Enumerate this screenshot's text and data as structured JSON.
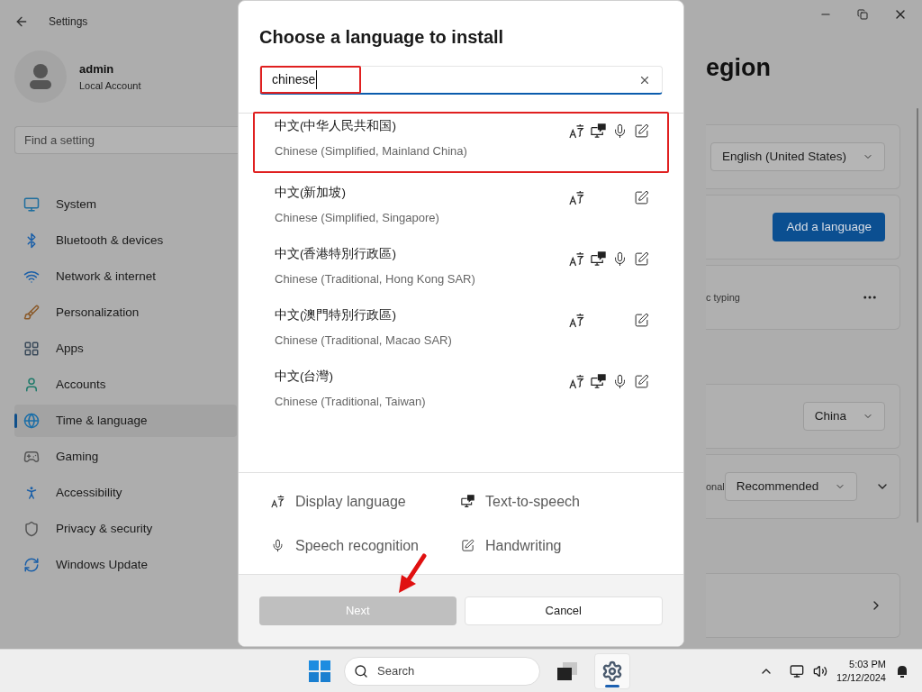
{
  "settings_window": {
    "title": "Settings",
    "user": {
      "name": "admin",
      "account": "Local Account"
    },
    "search": {
      "placeholder": "Find a setting"
    },
    "nav": [
      {
        "label": "System",
        "selected": false
      },
      {
        "label": "Bluetooth & devices",
        "selected": false
      },
      {
        "label": "Network & internet",
        "selected": false
      },
      {
        "label": "Personalization",
        "selected": false
      },
      {
        "label": "Apps",
        "selected": false
      },
      {
        "label": "Accounts",
        "selected": false
      },
      {
        "label": "Time & language",
        "selected": true
      },
      {
        "label": "Gaming",
        "selected": false
      },
      {
        "label": "Accessibility",
        "selected": false
      },
      {
        "label": "Privacy & security",
        "selected": false
      },
      {
        "label": "Windows Update",
        "selected": false
      }
    ],
    "page_heading": "egion",
    "sections": [
      {
        "cards": [
          {
            "kind": "dropdown",
            "value": "English (United States)",
            "expander": false
          },
          {
            "kind": "button",
            "label": "Add a language"
          },
          {
            "kind": "more",
            "text": "c typing"
          }
        ]
      },
      {
        "cards": [
          {
            "kind": "dropdown",
            "value": "China",
            "expander": false
          },
          {
            "kind": "dropdown",
            "text": "onal",
            "value": "Recommended",
            "expander": true
          }
        ]
      },
      {
        "cards": [
          {
            "kind": "link"
          }
        ]
      }
    ]
  },
  "dialog": {
    "title": "Choose a language to install",
    "search": {
      "value": "chinese",
      "marked": true
    },
    "languages": [
      {
        "native": "中文(中华人民共和国)",
        "english": "Chinese (Simplified, Mainland China)",
        "marked": true,
        "features": {
          "display_language": true,
          "text_to_speech": true,
          "speech_recognition": true,
          "handwriting": true
        }
      },
      {
        "native": "中文(新加坡)",
        "english": "Chinese (Simplified, Singapore)",
        "marked": false,
        "features": {
          "display_language": true,
          "text_to_speech": false,
          "speech_recognition": false,
          "handwriting": true
        }
      },
      {
        "native": "中文(香港特別行政區)",
        "english": "Chinese (Traditional, Hong Kong SAR)",
        "marked": false,
        "features": {
          "display_language": true,
          "text_to_speech": true,
          "speech_recognition": true,
          "handwriting": true
        }
      },
      {
        "native": "中文(澳門特別行政區)",
        "english": "Chinese (Traditional, Macao SAR)",
        "marked": false,
        "features": {
          "display_language": true,
          "text_to_speech": false,
          "speech_recognition": false,
          "handwriting": true
        }
      },
      {
        "native": "中文(台灣)",
        "english": "Chinese (Traditional, Taiwan)",
        "marked": false,
        "features": {
          "display_language": true,
          "text_to_speech": true,
          "speech_recognition": true,
          "handwriting": true
        }
      }
    ],
    "legend": [
      {
        "kind": "display_language",
        "label": "Display language"
      },
      {
        "kind": "text_to_speech",
        "label": "Text-to-speech"
      },
      {
        "kind": "speech_recognition",
        "label": "Speech recognition"
      },
      {
        "kind": "handwriting",
        "label": "Handwriting"
      }
    ],
    "buttons": [
      {
        "kind": "primary",
        "label": "Next",
        "disabled": true
      },
      {
        "kind": "secondary",
        "label": "Cancel",
        "disabled": false
      }
    ],
    "annotations": [
      {
        "kind": "arrow"
      }
    ]
  },
  "taskbar": {
    "search": {
      "placeholder": "Search"
    },
    "apps": [
      {
        "selected": false
      },
      {
        "selected": true
      }
    ],
    "time": "5:03 PM",
    "date": "12/12/2024"
  }
}
